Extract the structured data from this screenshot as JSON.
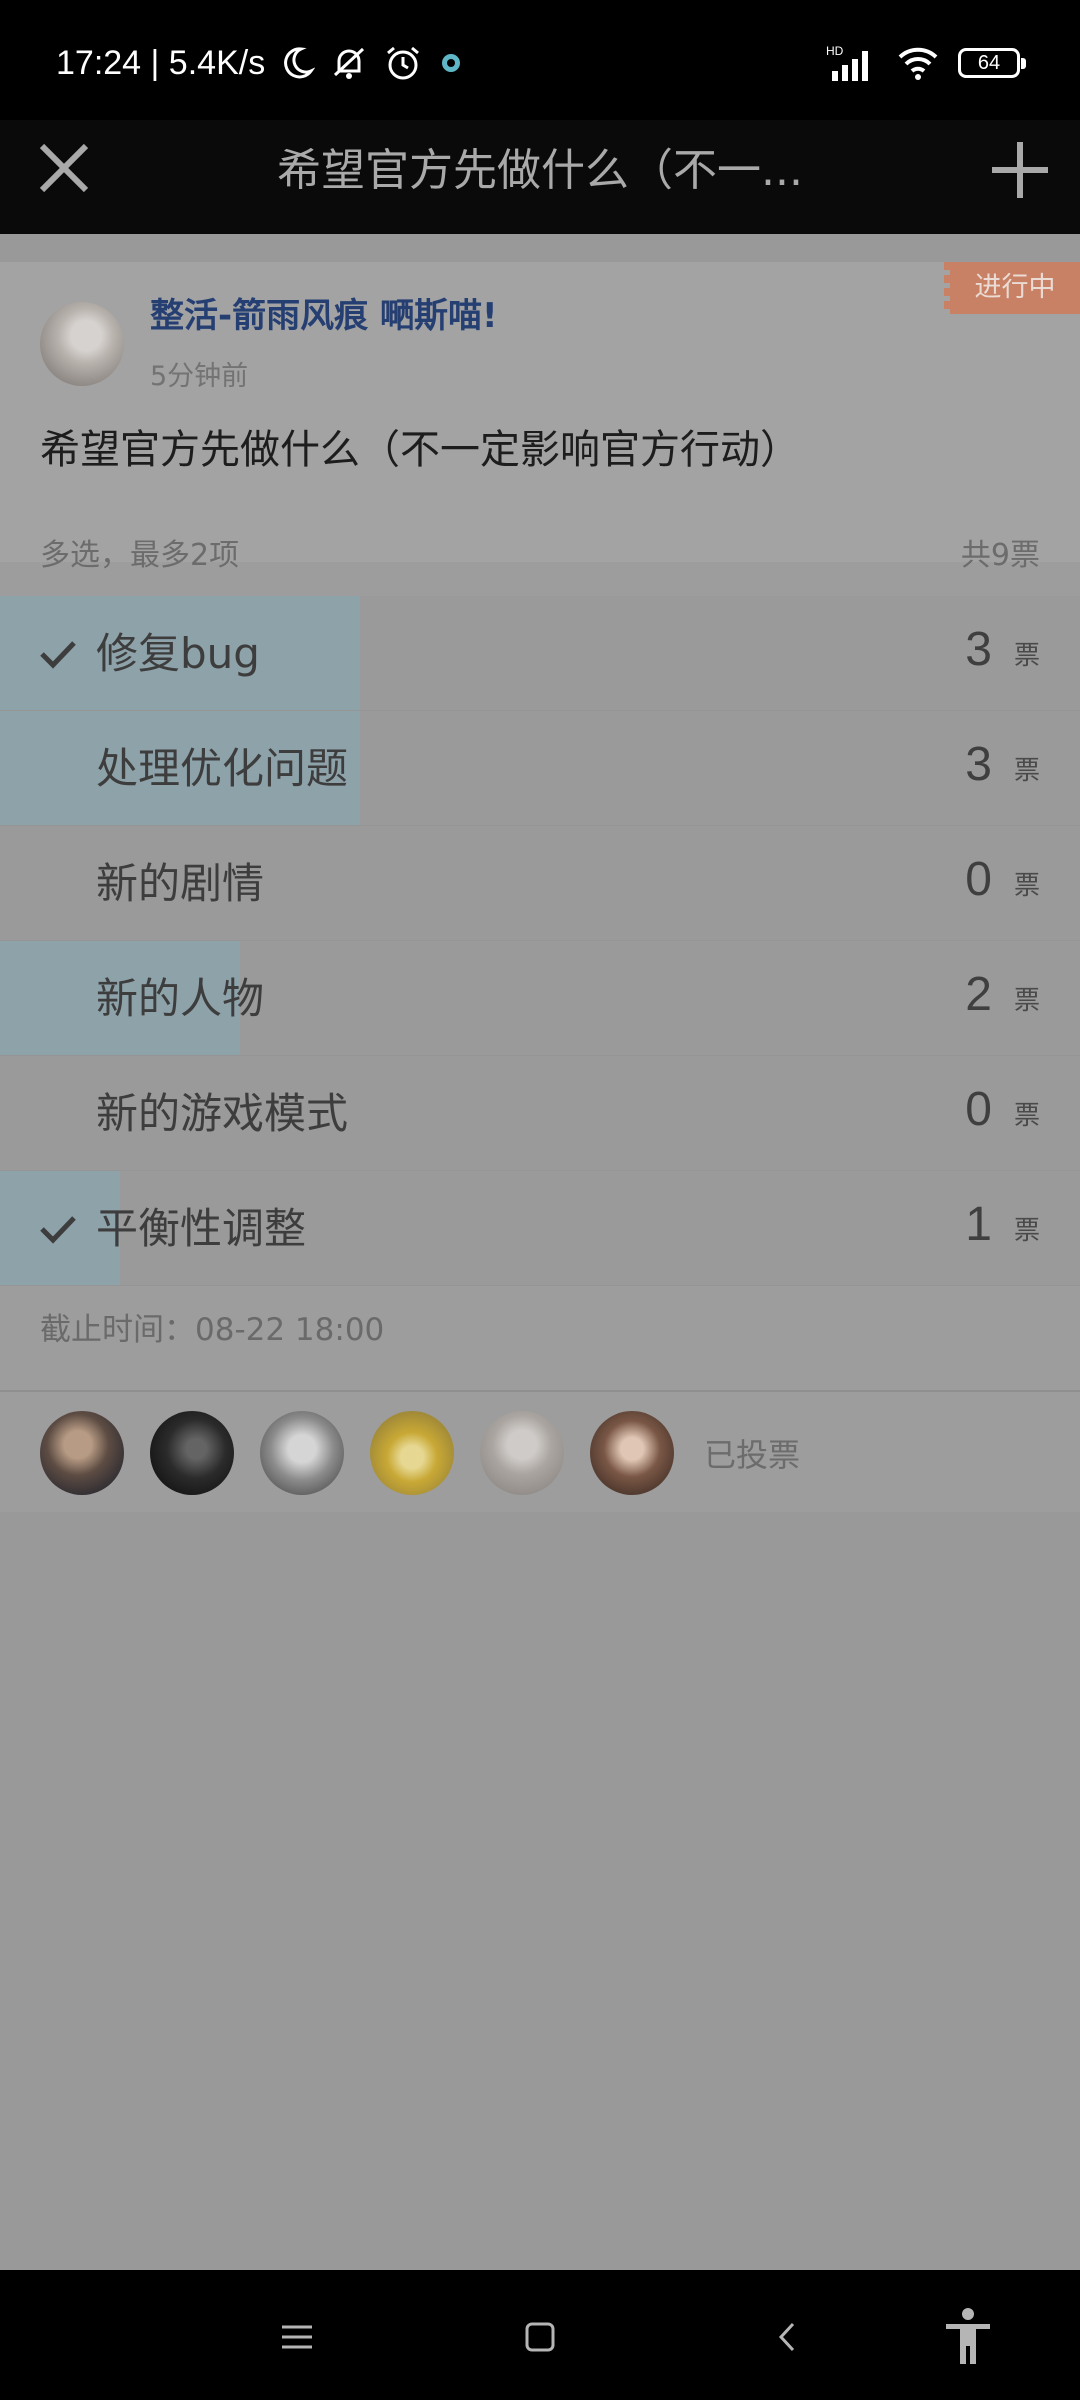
{
  "status_bar": {
    "time_speed": "17:24 | 5.4K/s",
    "battery": "64",
    "network_label": "HD"
  },
  "header": {
    "title": "希望官方先做什么（不一..."
  },
  "poll": {
    "status_badge": "进行中",
    "author": "整活-箭雨风痕 嗮斯喵!",
    "time_ago": "5分钟前",
    "title": "希望官方先做什么（不一定影响官方行动）",
    "mode": "多选，最多2项",
    "total": "共9票",
    "vote_unit": "票",
    "options": [
      {
        "label": "修复bug",
        "votes": "3",
        "share": 0.333,
        "checked": true
      },
      {
        "label": "处理优化问题",
        "votes": "3",
        "share": 0.333,
        "checked": false
      },
      {
        "label": "新的剧情",
        "votes": "0",
        "share": 0,
        "checked": false
      },
      {
        "label": "新的人物",
        "votes": "2",
        "share": 0.222,
        "checked": false
      },
      {
        "label": "新的游戏模式",
        "votes": "0",
        "share": 0,
        "checked": false
      },
      {
        "label": "平衡性调整",
        "votes": "1",
        "share": 0.111,
        "checked": true
      }
    ],
    "deadline": "截止时间：08-22 18:00",
    "voted_label": "已投票"
  },
  "colors": {
    "fill": "#8ea2aa",
    "badge": "#c98166",
    "author": "#263f73"
  }
}
